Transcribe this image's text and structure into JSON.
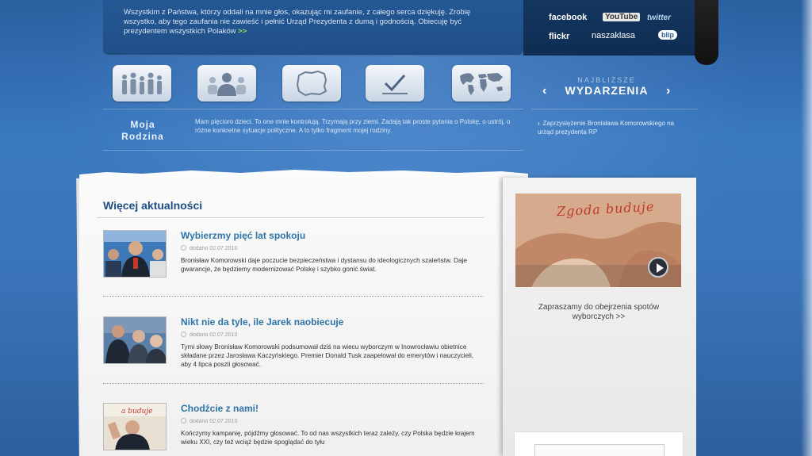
{
  "top": {
    "message": "Wszystkim z Państwa, którzy oddali na mnie głos, okazując mi zaufanie,  z całego serca dziękuję. Zrobię wszystko, aby tego zaufania nie zawieść i pełnić Urząd  Prezydenta z dumą i godnością. Obiecuję  być prezydentem wszystkich Polaków",
    "more": ">>"
  },
  "social": {
    "facebook": "facebook",
    "youtube": "YouTube",
    "twitter": "twitter",
    "flickr": "flickr",
    "naszaklasa": "naszaklasa",
    "blip": "blip"
  },
  "icons": [
    {
      "name": "family-icon"
    },
    {
      "name": "person-icon"
    },
    {
      "name": "poland-map-icon"
    },
    {
      "name": "checkmark-icon"
    },
    {
      "name": "world-map-icon"
    }
  ],
  "moja_rodzina": {
    "line1": "Moja",
    "line2": "Rodzina"
  },
  "description": "Mam pięcioro dzieci. To one mnie kontrolują. Trzymają przy ziemi. Zadają tak proste pytania o Polskę, o ustrój, o różne konkretne sytuacje polityczne. A to tylko fragment mojej rodziny.",
  "events": {
    "kicker": "NAJBLIŻSZE",
    "title": "WYDARZENIA",
    "prev": "‹",
    "next": "›",
    "item": "Zaprzysiężenie Bronisława Komorowskiego na urząd prezydenta RP"
  },
  "news": {
    "section_title": "Więcej aktualności",
    "articles": [
      {
        "title": "Wybierzmy pięć lat spokoju",
        "date": "dodano 02.07.2010",
        "text": "Bronisław Komorowski daje poczucie bezpieczeństwa i dystansu do ideologicznych szaleństw. Daje gwarancje, że będziemy modernizować Polskę i szybko gonić świat."
      },
      {
        "title": "Nikt nie da tyle, ile Jarek naobiecuje",
        "date": "dodano 02.07.2010",
        "text": "Tymi słowy Bronisław Komorowski podsumował dziś na wiecu wyborczym w Inowrocławiu obietnice składane przez Jarosława Kaczyńskiego. Premier Donald Tusk zaapelował do emerytów i nauczycieli, aby 4 lipca poszli głosować."
      },
      {
        "title": "Chodźcie z nami!",
        "date": "dodano 02.07.2010",
        "text": "Kończymy kampanię, pójdźmy głosować. To od nas wszystkich teraz zależy, czy Polska będzie krajem wieku XXI, czy też wciąż będzie spoglądać do tyłu"
      }
    ]
  },
  "sidebar": {
    "video_overlay": "Zgoda buduje",
    "invite": "Zapraszamy do obejrzenia spotów wyborczych >>"
  }
}
